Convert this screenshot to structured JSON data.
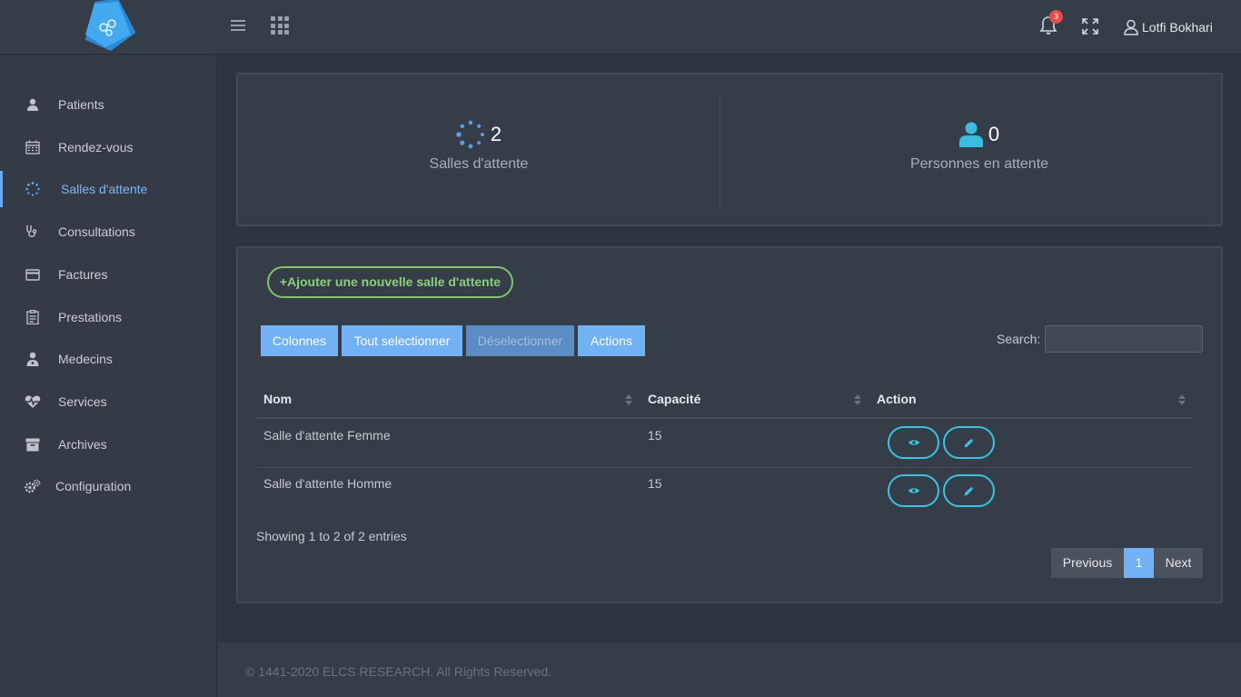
{
  "header": {
    "notification_count": "3",
    "user_name": "Lotfi Bokhari"
  },
  "sidebar": {
    "items": [
      {
        "label": "Patients",
        "icon": "user-icon"
      },
      {
        "label": "Rendez-vous",
        "icon": "calendar-icon"
      },
      {
        "label": "Salles d'attente",
        "icon": "spinner-icon",
        "active": true
      },
      {
        "label": "Consultations",
        "icon": "stethoscope-icon"
      },
      {
        "label": "Factures",
        "icon": "credit-card-icon"
      },
      {
        "label": "Prestations",
        "icon": "clipboard-icon"
      },
      {
        "label": "Medecins",
        "icon": "doctor-icon"
      },
      {
        "label": "Services",
        "icon": "heartbeat-icon"
      },
      {
        "label": "Archives",
        "icon": "archive-icon"
      },
      {
        "label": "Configuration",
        "icon": "gears-icon"
      }
    ]
  },
  "stats": {
    "rooms": {
      "value": "2",
      "label": "Salles d'attente"
    },
    "waiting": {
      "value": "0",
      "label": "Personnes en attente"
    }
  },
  "toolbar": {
    "add_label": "+Ajouter une nouvelle salle d'attente",
    "columns_label": "Colonnes",
    "select_all_label": "Tout selectionner",
    "deselect_label": "Déselectionner",
    "actions_label": "Actions",
    "search_label": "Search:",
    "search_value": ""
  },
  "table": {
    "headers": [
      "Nom",
      "Capacité",
      "Action"
    ],
    "rows": [
      {
        "nom": "Salle d'attente Femme",
        "capacite": "15"
      },
      {
        "nom": "Salle d'attente Homme",
        "capacite": "15"
      }
    ],
    "info": "Showing 1 to 2 of 2 entries"
  },
  "pagination": {
    "previous": "Previous",
    "page": "1",
    "next": "Next"
  },
  "footer": {
    "text": "© 1441-2020 ELCS RESEARCH. All Rights Reserved."
  },
  "colors": {
    "accent": "#73b1f5",
    "success": "#7fc56f",
    "action": "#3bc3df",
    "danger": "#e84b4b"
  }
}
